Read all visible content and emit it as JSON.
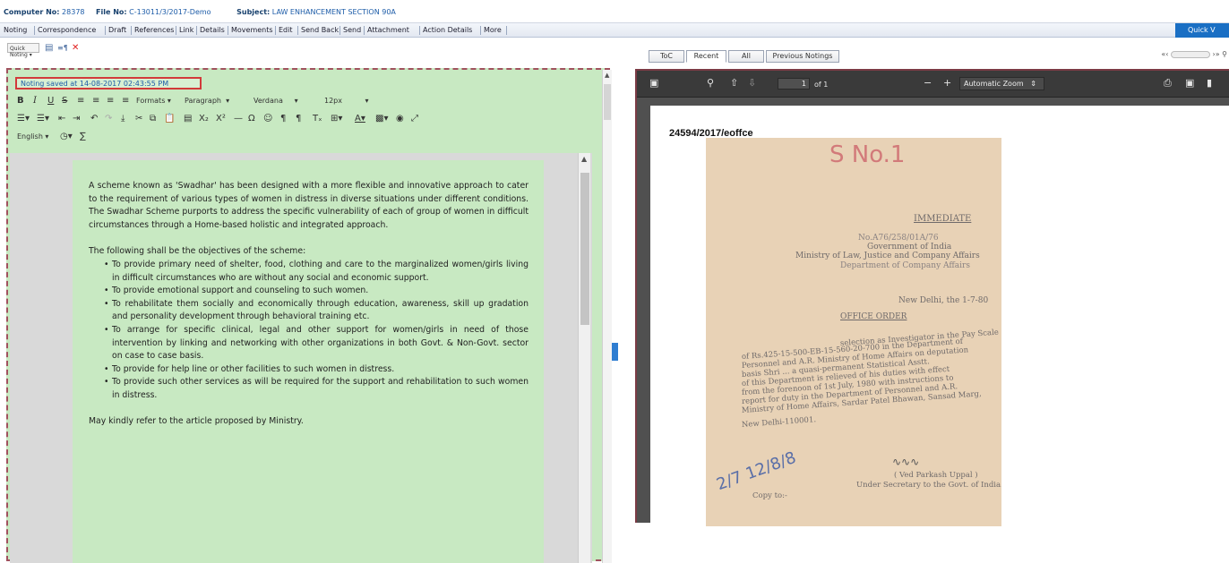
{
  "header": {
    "computer_no_label": "Computer No:",
    "computer_no": "28378",
    "file_no_label": "File No:",
    "file_no": "C-13011/3/2017-Demo",
    "subject_label": "Subject:",
    "subject": "LAW ENHANCEMENT SECTION 90A"
  },
  "menu": {
    "items": [
      "Noting",
      "Correspondence",
      "Draft",
      "References",
      "Link",
      "Details",
      "Movements",
      "Edit",
      "Send Back",
      "Send",
      "Attachment",
      "Action Details",
      "More"
    ],
    "quick_label": "Quick V"
  },
  "left": {
    "quick_noting": "Quick Noting ▾",
    "saved_status": "Noting saved at 14-08-2017 02:43:55 PM",
    "formats": "Formats ▾",
    "paragraph": "Paragraph",
    "font": "Verdana",
    "size": "12px",
    "language": "English ▾",
    "paragraphs": [
      "A scheme known as 'Swadhar' has been designed with a more flexible and innovative approach to cater to the requirement of various types of women in distress in diverse situations under different conditions. The Swadhar Scheme purports to address the specific vulnerability of each of group of women in difficult circumstances through a Home-based holistic and integrated approach.",
      "The following shall be the objectives of the scheme:"
    ],
    "bullets": [
      "To provide primary need of shelter, food, clothing and care to the marginalized women/girls living in difficult circumstances who are without any social and economic support.",
      "To provide emotional support and counseling to such women.",
      "To rehabilitate them socially and economically through education, awareness, skill up gradation and personality development through behavioral training etc.",
      "To arrange for specific clinical, legal and other support for women/girls in need of those intervention by linking and networking with other organizations in both Govt. & Non-Govt. sector on case to case basis.",
      "To provide for help line or other facilities to such women in distress.",
      "To provide such other services as will be required for the support and rehabilitation to such women in distress."
    ],
    "closing": "May kindly refer to the article proposed by Ministry."
  },
  "right": {
    "tabs": [
      "ToC",
      "Recent",
      "All",
      "Previous Notings"
    ],
    "page_input": "1",
    "page_total": "of 1",
    "zoom": "Automatic Zoom",
    "doc_id": "24594/2017/eoffce",
    "scan_lines": [
      "S No.1",
      "IMMEDIATE",
      "No.A76/258/01A/76",
      "Government of India",
      "Ministry of Law, Justice and Company Affairs",
      "Department of Company Affairs",
      "New Delhi, the 1-7-80",
      "OFFICE ORDER",
      "selection as Investigator in the Pay Scale",
      "of Rs.425-15-500-EB-15-560-20-700 in the Department of",
      "Personnel and A.R. Ministry of Home Affairs on deputation",
      "basis Shri ... a quasi-permanent Statistical Asstt.",
      "of this Department is relieved of his duties with effect",
      "from the forenoon of 1st July, 1980 with instructions to",
      "report for duty in the Department of Personnel and A.R.",
      "Ministry of Home Affairs, Sardar Patel Bhawan, Sansad Marg,",
      "New Delhi-110001.",
      "( Ved Parkash Uppal )",
      "Under Secretary to the Govt. of India.",
      "Copy to:-"
    ]
  }
}
